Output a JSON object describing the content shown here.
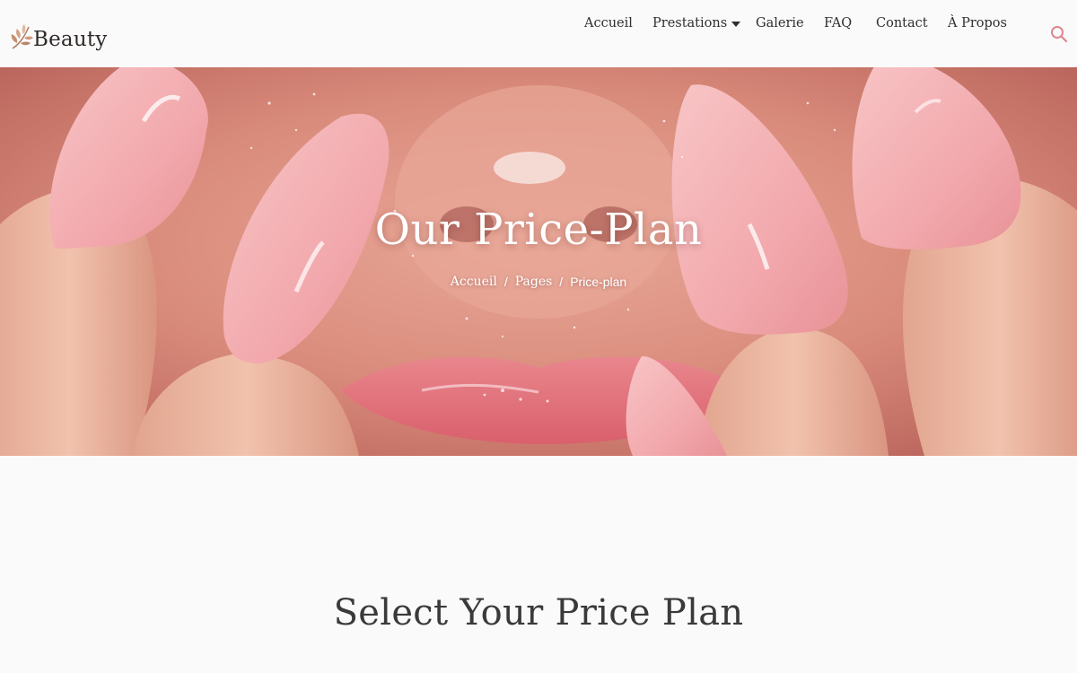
{
  "brand": {
    "name": "Beauty",
    "logo_icon": "leaf-logo-icon"
  },
  "nav": {
    "items": [
      {
        "label": "Accueil"
      },
      {
        "label": "Prestations",
        "dropdown": true
      },
      {
        "label": "Galerie"
      },
      {
        "label": "FAQ"
      },
      {
        "label": "Contact"
      },
      {
        "label": "À Propos"
      }
    ],
    "search_icon": "search-icon"
  },
  "hero": {
    "title": "Our Price-Plan",
    "breadcrumb": {
      "home": "Accueil",
      "pages": "Pages",
      "separator": "/",
      "current": "Price-plan"
    }
  },
  "section": {
    "title": "Select Your Price Plan"
  },
  "colors": {
    "accent": "#e0868f",
    "background": "#fafafa",
    "text": "#2f2f2f",
    "nail_pink": "#f4b3b5"
  }
}
